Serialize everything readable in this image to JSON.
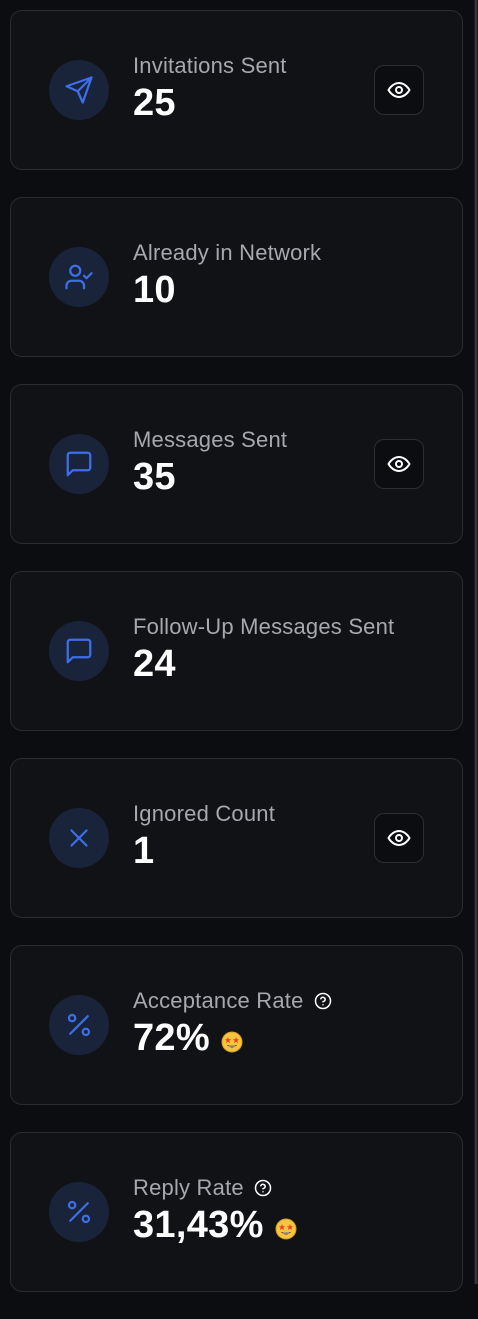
{
  "colors": {
    "background": "#0c0d10",
    "card": "#111216",
    "card_border": "#2a2c32",
    "accent": "#3d6fe8",
    "icon_bg": "#19233a",
    "label": "#a6a8ad",
    "value": "#ffffff"
  },
  "stats": [
    {
      "label": "Invitations Sent",
      "value": "25",
      "icon": "send-icon",
      "has_view_button": true
    },
    {
      "label": "Already in Network",
      "value": "10",
      "icon": "user-check-icon",
      "has_view_button": false
    },
    {
      "label": "Messages Sent",
      "value": "35",
      "icon": "message-square-icon",
      "has_view_button": true
    },
    {
      "label": "Follow-Up Messages Sent",
      "value": "24",
      "icon": "message-square-icon",
      "has_view_button": false
    },
    {
      "label": "Ignored Count",
      "value": "1",
      "icon": "x-icon",
      "has_view_button": true
    },
    {
      "label": "Acceptance Rate",
      "value": "72%",
      "icon": "percent-icon",
      "has_help": true,
      "emoji": "star-struck-emoji"
    },
    {
      "label": "Reply Rate",
      "value": "31,43%",
      "icon": "percent-icon",
      "has_help": true,
      "emoji": "star-struck-emoji"
    }
  ]
}
